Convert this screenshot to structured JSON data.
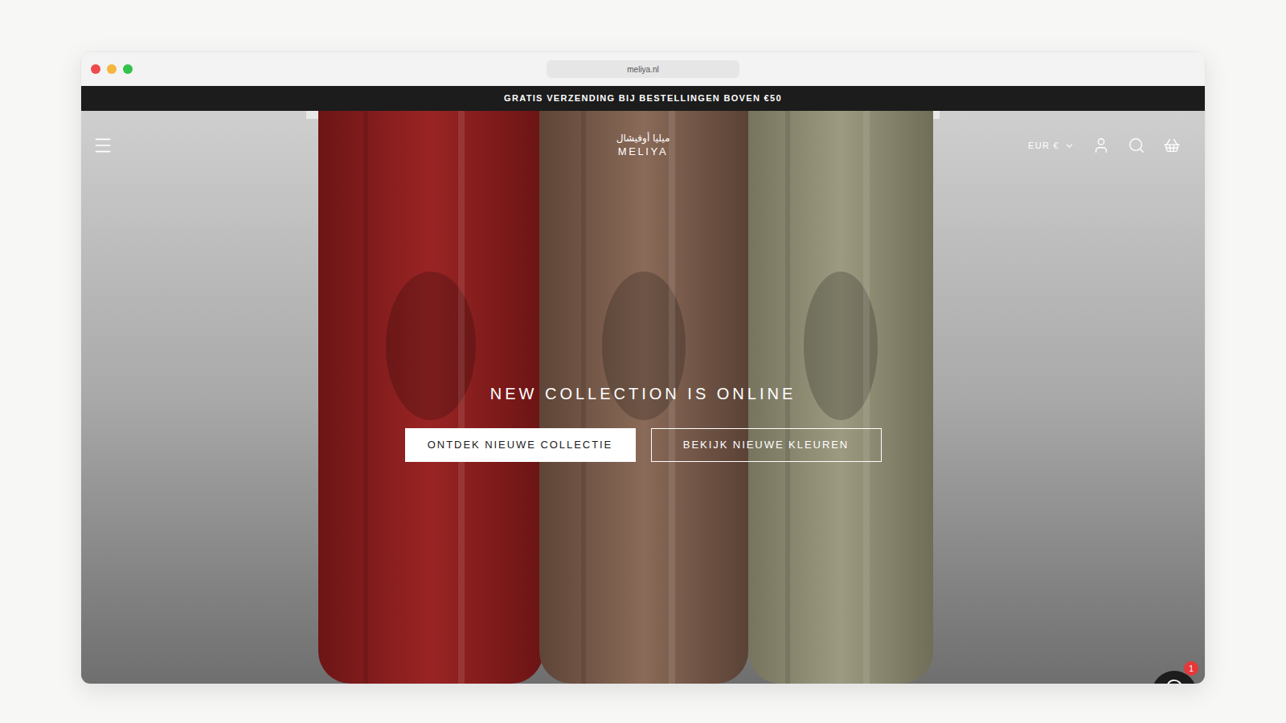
{
  "browser": {
    "url": "meliya.nl"
  },
  "announcement": "GRATIS VERZENDING BIJ BESTELLINGEN BOVEN €50",
  "header": {
    "logo_arabic": "ميليا أوفيشال",
    "logo": "MELIYA",
    "currency": "EUR €"
  },
  "hero": {
    "title": "NEW COLLECTION IS ONLINE",
    "buttons": [
      {
        "label": "ONTDEK NIEUWE COLLECTIE",
        "kind": "filled"
      },
      {
        "label": "BEKIJK NIEUWE KLEUREN",
        "kind": "outline"
      }
    ]
  },
  "chat": {
    "badge": "1"
  }
}
